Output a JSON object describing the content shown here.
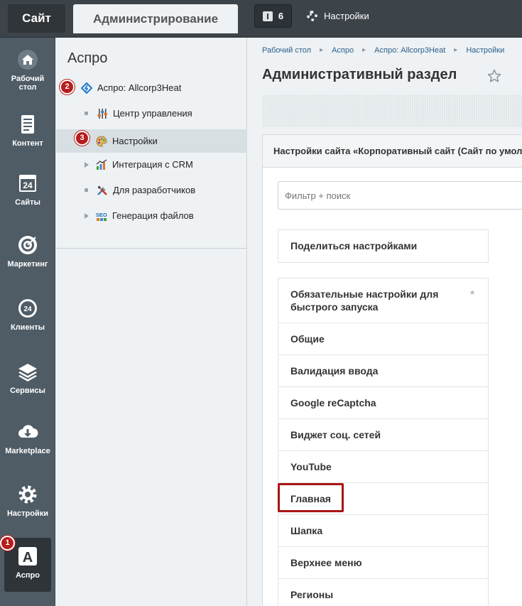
{
  "topbar": {
    "site_tab": "Сайт",
    "admin_tab": "Администрирование",
    "notifications_count": "6",
    "settings_label": "Настройки"
  },
  "leftnav": {
    "items": [
      {
        "label": "Рабочий стол",
        "icon": "home-icon"
      },
      {
        "label": "Контент",
        "icon": "document-icon"
      },
      {
        "label": "Сайты",
        "icon": "calendar-24-icon"
      },
      {
        "label": "Маркетинг",
        "icon": "target-icon"
      },
      {
        "label": "Клиенты",
        "icon": "clients-24-icon"
      },
      {
        "label": "Сервисы",
        "icon": "layers-icon"
      },
      {
        "label": "Marketplace",
        "icon": "cloud-download-icon"
      },
      {
        "label": "Настройки",
        "icon": "gear-icon"
      },
      {
        "label": "Аспро",
        "icon": "aspro-logo-icon",
        "active": true
      }
    ],
    "badge": "1"
  },
  "sidepanel": {
    "title": "Аспро",
    "items": [
      {
        "label": "Аспро: Allcorp3Heat",
        "badge": "2"
      },
      {
        "label": "Центр управления"
      },
      {
        "label": "Настройки",
        "badge": "3",
        "selected": true
      },
      {
        "label": "Интеграция с CRM"
      },
      {
        "label": "Для разработчиков"
      },
      {
        "label": "Генерация файлов"
      }
    ]
  },
  "main": {
    "breadcrumbs": [
      "Рабочий стол",
      "Аспро",
      "Аспро: Allcorp3Heat",
      "Настройки"
    ],
    "title": "Административный раздел",
    "settings_header": "Настройки сайта «Корпоративный сайт (Сайт по умол",
    "filter_placeholder": "Фильтр + поиск",
    "share_label": "Поделиться настройками",
    "required_mark": "*",
    "sections": [
      "Обязательные настройки для быстрого запуска",
      "Общие",
      "Валидация ввода",
      "Google reCaptcha",
      "Виджет соц. сетей",
      "YouTube",
      "Главная",
      "Шапка",
      "Верхнее меню",
      "Регионы"
    ]
  },
  "colors": {
    "topbar": "#3c4349",
    "leftnav": "#4f5c66",
    "badge": "#b51d1d",
    "highlight": "#a91414",
    "link": "#2c5f8a"
  }
}
